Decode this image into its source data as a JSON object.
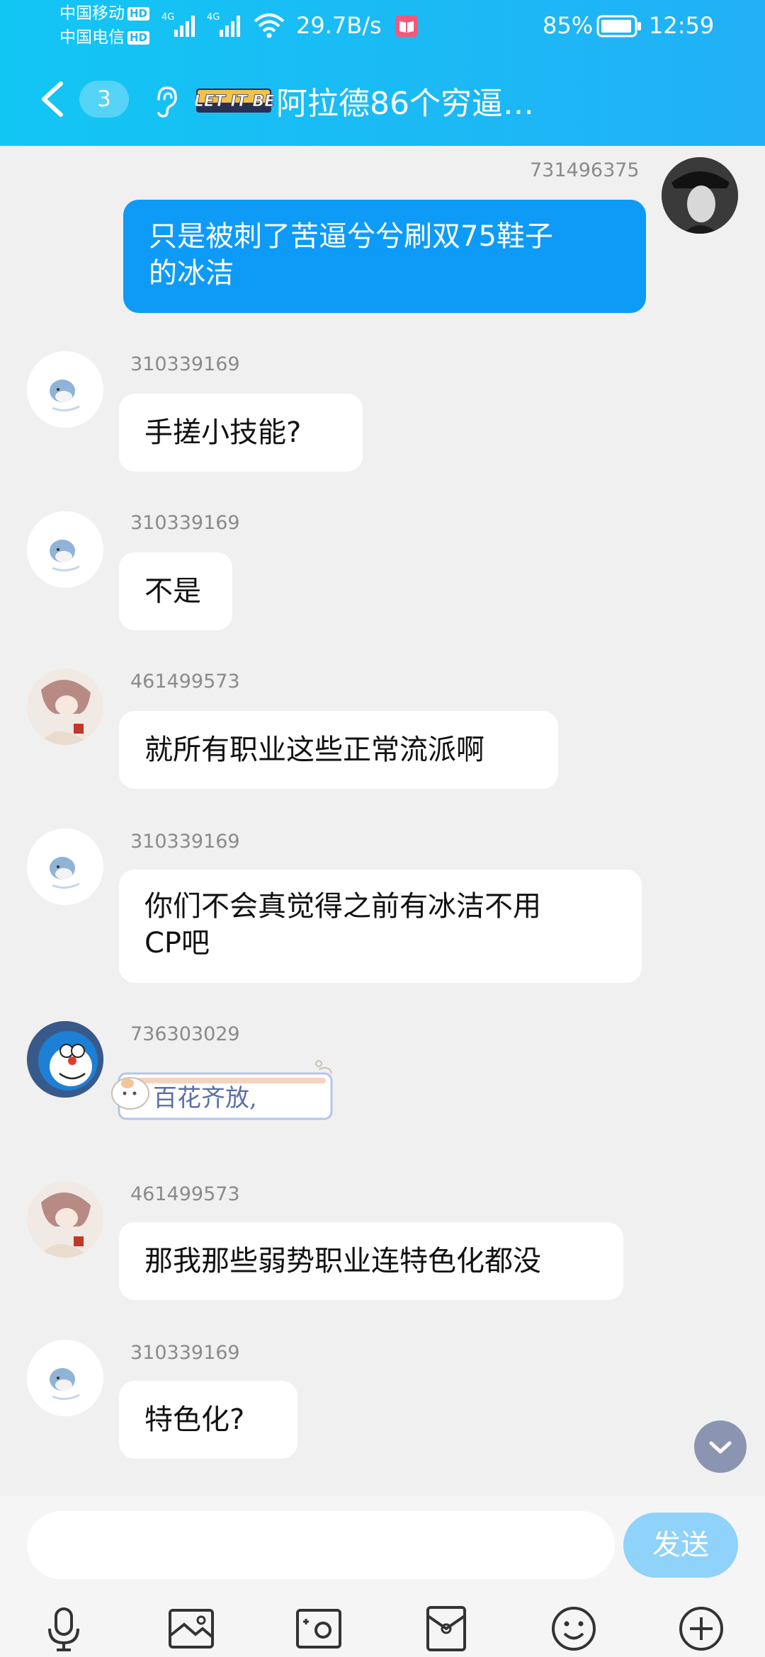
{
  "status_bar": {
    "carrier1": "中国移动",
    "carrier2": "中国电信",
    "hd": "HD",
    "net": "4G",
    "speed": "29.7B/s",
    "battery": "85%",
    "time": "12:59"
  },
  "header": {
    "unread_count": "3",
    "logo_text": "LET IT BE",
    "group_title": "阿拉德86个穷逼…"
  },
  "messages": [
    {
      "sender": "731496375",
      "text_lines": [
        "只是被刺了苦逼兮兮刷双75鞋子",
        "的冰洁"
      ],
      "mine": true
    },
    {
      "sender": "310339169",
      "text_lines": [
        "手搓小技能?"
      ]
    },
    {
      "sender": "310339169",
      "text_lines": [
        "不是"
      ]
    },
    {
      "sender": "461499573",
      "text_lines": [
        "就所有职业这些正常流派啊"
      ]
    },
    {
      "sender": "310339169",
      "text_lines": [
        "你们不会真觉得之前有冰洁不用",
        "CP吧"
      ]
    },
    {
      "sender": "736303029",
      "sticker_text": "百花齐放,"
    },
    {
      "sender": "461499573",
      "text_lines": [
        "那我那些弱势职业连特色化都没"
      ]
    },
    {
      "sender": "310339169",
      "text_lines": [
        "特色化?"
      ]
    }
  ],
  "input": {
    "value": "",
    "placeholder": "",
    "send_label": "发送"
  },
  "toolbar": [
    "microphone-icon",
    "photo-icon",
    "camera-icon",
    "red-packet-icon",
    "emoji-icon",
    "plus-icon"
  ],
  "colors": {
    "header": "#12c6f4",
    "my_bubble": "#0d9bf7",
    "send_button": "#8fd2fa",
    "background": "#f0f0f0"
  }
}
